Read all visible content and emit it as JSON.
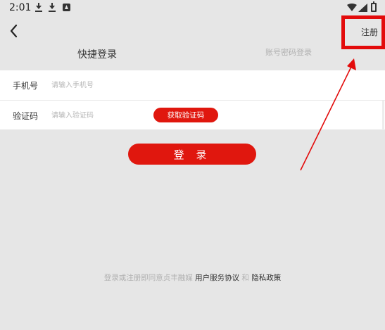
{
  "status_bar": {
    "time": "2:01",
    "icons": [
      "download-icon",
      "download-icon",
      "android-icon",
      "wifi-icon",
      "cell-signal-icon",
      "battery-icon"
    ]
  },
  "header": {
    "back_icon": "chevron-left-icon",
    "register_label": "注册"
  },
  "tabs": {
    "quick_login": "快捷登录",
    "password_login": "账号密码登录"
  },
  "form": {
    "phone_label": "手机号",
    "phone_placeholder": "请输入手机号",
    "phone_value": "",
    "code_label": "验证码",
    "code_placeholder": "请输入验证码",
    "code_value": "",
    "get_code_button": "获取验证码"
  },
  "login_button": "登 录",
  "agreement": {
    "prefix": "登录或注册即同意贞丰融媒",
    "user_agreement": "用户服务协议",
    "conjunction": "和",
    "privacy_policy": "隐私政策"
  },
  "colors": {
    "accent": "#e0170e",
    "background": "#e6e6e6",
    "annotation": "#e30b0b"
  }
}
